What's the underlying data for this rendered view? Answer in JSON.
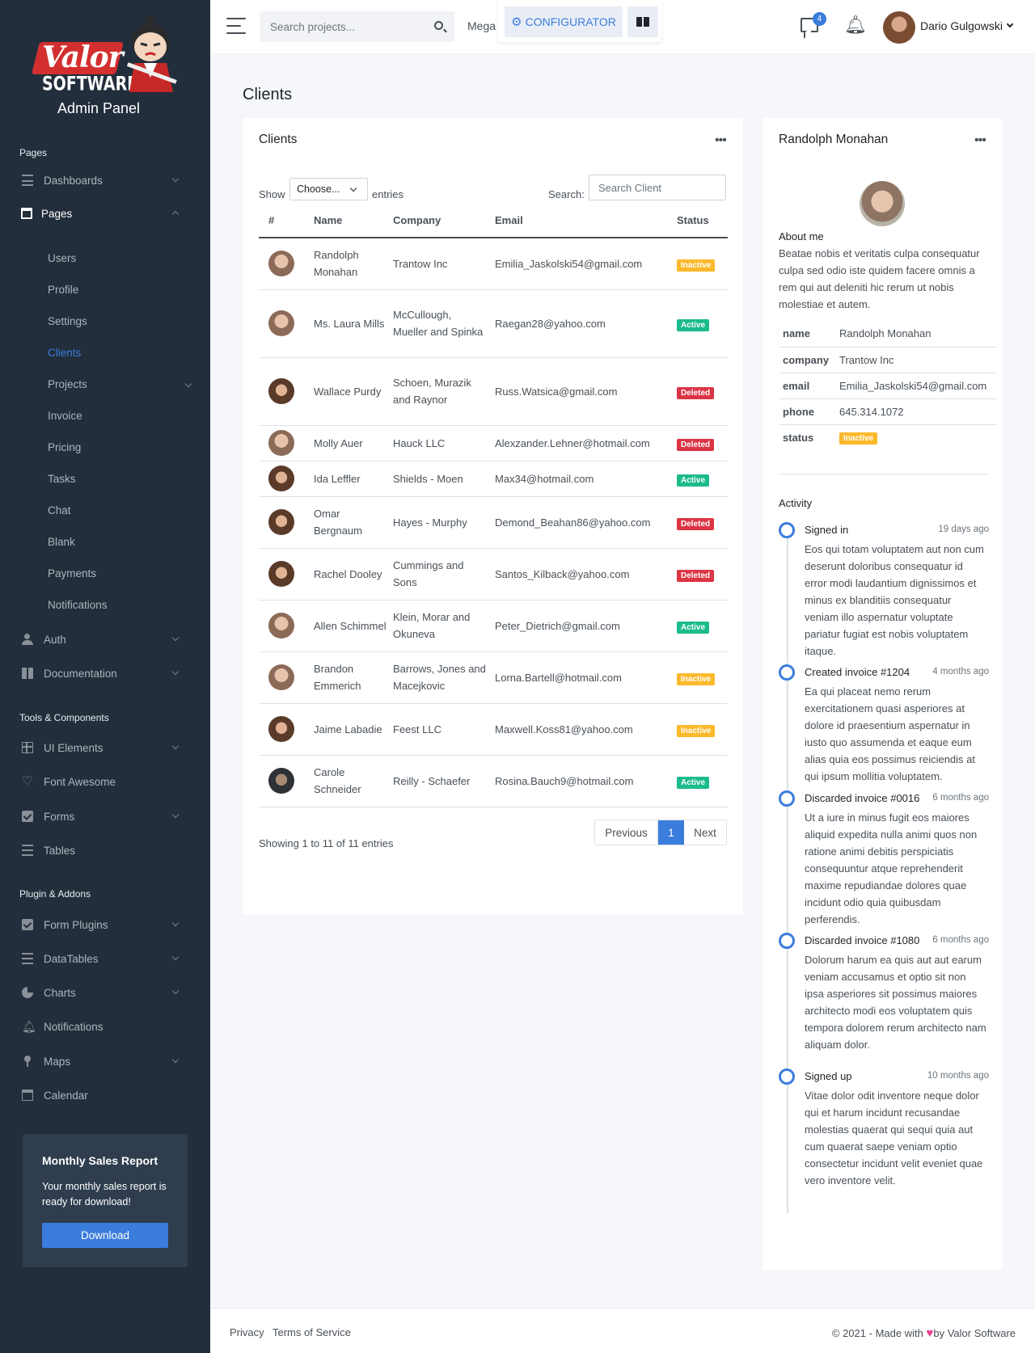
{
  "brand": {
    "logo_text": "Valor",
    "logo_sub": "SOFTWARE",
    "title": "Admin Panel"
  },
  "sidebar": {
    "sections": [
      "Pages",
      "Tools & Components",
      "Plugin & Addons"
    ],
    "pages": [
      {
        "label": "Dashboards",
        "icon": "sliders-icon"
      },
      {
        "label": "Pages",
        "icon": "window-icon"
      }
    ],
    "sub_items": [
      "Users",
      "Profile",
      "Settings",
      "Clients",
      "Projects",
      "Invoice",
      "Pricing",
      "Tasks",
      "Chat",
      "Blank",
      "Payments",
      "Notifications"
    ],
    "pages2": [
      {
        "label": "Auth",
        "icon": "users-icon"
      },
      {
        "label": "Documentation",
        "icon": "book-icon"
      }
    ],
    "tools": [
      {
        "label": "UI Elements",
        "icon": "grid-icon"
      },
      {
        "label": "Font Awesome",
        "icon": "heart-icon"
      },
      {
        "label": "Forms",
        "icon": "check-square-icon"
      },
      {
        "label": "Tables",
        "icon": "list-icon"
      }
    ],
    "plugins": [
      {
        "label": "Form Plugins",
        "icon": "check-square-icon"
      },
      {
        "label": "DataTables",
        "icon": "list-icon"
      },
      {
        "label": "Charts",
        "icon": "pie-chart-icon"
      },
      {
        "label": "Notifications",
        "icon": "bell-icon"
      },
      {
        "label": "Maps",
        "icon": "map-pin-icon"
      },
      {
        "label": "Calendar",
        "icon": "calendar-icon"
      }
    ],
    "promo": {
      "title": "Monthly Sales Report",
      "text": "Your monthly sales report is ready for download!",
      "button": "Download"
    }
  },
  "topbar": {
    "search_placeholder": "Search projects...",
    "mega": "Mega",
    "configurator": "CONFIGURATOR",
    "messages_count": "4",
    "user_name": "Dario Gulgowski"
  },
  "main": {
    "page_title": "Clients",
    "clients_card": {
      "title": "Clients",
      "show": "Show",
      "choose": "Choose...",
      "entries": "entries",
      "search_label": "Search:",
      "search_placeholder": "Search Client",
      "columns": [
        "#",
        "Name",
        "Company",
        "Email",
        "Status"
      ],
      "rows": [
        {
          "name": "Randolph Monahan",
          "company": "Trantow Inc",
          "email": "Emilia_Jaskolski54@gmail.com",
          "status": "Inactive",
          "avatar": "m"
        },
        {
          "name": "Ms. Laura Mills",
          "company": "McCullough, Mueller and Spinka",
          "email": "Raegan28@yahoo.com",
          "status": "Active",
          "avatar": "m"
        },
        {
          "name": "Wallace Purdy",
          "company": "Schoen, Murazik and Raynor",
          "email": "Russ.Watsica@gmail.com",
          "status": "Deleted",
          "avatar": "f"
        },
        {
          "name": "Molly Auer",
          "company": "Hauck LLC",
          "email": "Alexzander.Lehner@hotmail.com",
          "status": "Deleted",
          "avatar": "m"
        },
        {
          "name": "Ida Leffler",
          "company": "Shields - Moen",
          "email": "Max34@hotmail.com",
          "status": "Active",
          "avatar": "f"
        },
        {
          "name": "Omar Bergnaum",
          "company": "Hayes - Murphy",
          "email": "Demond_Beahan86@yahoo.com",
          "status": "Deleted",
          "avatar": "f"
        },
        {
          "name": "Rachel Dooley",
          "company": "Cummings and Sons",
          "email": "Santos_Kilback@yahoo.com",
          "status": "Deleted",
          "avatar": "f"
        },
        {
          "name": "Allen Schimmel",
          "company": "Klein, Morar and Okuneva",
          "email": "Peter_Dietrich@gmail.com",
          "status": "Active",
          "avatar": "m"
        },
        {
          "name": "Brandon Emmerich",
          "company": "Barrows, Jones and Macejkovic",
          "email": "Lorna.Bartell@hotmail.com",
          "status": "Inactive",
          "avatar": "m"
        },
        {
          "name": "Jaime Labadie",
          "company": "Feest LLC",
          "email": "Maxwell.Koss81@yahoo.com",
          "status": "Inactive",
          "avatar": "f"
        },
        {
          "name": "Carole Schneider",
          "company": "Reilly - Schaefer",
          "email": "Rosina.Bauch9@hotmail.com",
          "status": "Active",
          "avatar": "d"
        }
      ],
      "showing": "Showing 1 to 11 of 11 entries",
      "pager": {
        "prev": "Previous",
        "page": "1",
        "next": "Next"
      }
    },
    "profile_card": {
      "title": "Randolph Monahan",
      "about_title": "About me",
      "about_text": "Beatae nobis et veritatis culpa consequatur culpa sed odio iste quidem facere omnis a rem qui aut deleniti hic rerum ut nobis molestiae et autem.",
      "info": [
        {
          "key": "name",
          "value": "Randolph Monahan"
        },
        {
          "key": "company",
          "value": "Trantow Inc"
        },
        {
          "key": "email",
          "value": "Emilia_Jaskolski54@gmail.com"
        },
        {
          "key": "phone",
          "value": "645.314.1072"
        },
        {
          "key": "status",
          "value": "Inactive"
        }
      ],
      "activity_title": "Activity",
      "activity": [
        {
          "title": "Signed in",
          "time": "19 days ago",
          "text": "Eos qui totam voluptatem aut non cum deserunt doloribus consequatur id error modi laudantium dignissimos et minus ex blanditiis consequatur veniam illo aspernatur voluptate pariatur fugiat est nobis voluptatem itaque."
        },
        {
          "title": "Created invoice #1204",
          "time": "4 months ago",
          "text": "Ea qui placeat nemo rerum exercitationem quasi asperiores at dolore id praesentium aspernatur in iusto quo assumenda et eaque eum alias quia eos possimus reiciendis at qui ipsum mollitia voluptatem."
        },
        {
          "title": "Discarded invoice #0016",
          "time": "6 months ago",
          "text": "Ut a iure in minus fugit eos maiores aliquid expedita nulla animi quos non ratione animi debitis perspiciatis consequuntur atque reprehenderit maxime repudiandae dolores quae incidunt odio quia quibusdam perferendis."
        },
        {
          "title": "Discarded invoice #1080",
          "time": "6 months ago",
          "text": "Dolorum harum ea quis aut aut earum veniam accusamus et optio sit non ipsa asperiores sit possimus maiores architecto modi eos voluptatem quis tempora dolorem rerum architecto nam aliquam dolor."
        },
        {
          "title": "Signed up",
          "time": "10 months ago",
          "text": "Vitae dolor odit inventore neque dolor qui et harum incidunt recusandae molestias quaerat qui sequi quia aut cum quaerat saepe veniam optio consectetur incidunt velit eveniet quae vero inventore velit."
        }
      ]
    }
  },
  "footer": {
    "privacy": "Privacy",
    "terms": "Terms of Service",
    "copy_pre": "© 2021 - Made with",
    "copy_post": "by Valor Software"
  },
  "colors": {
    "sidebar": "#222e3c",
    "accent": "#3b7ddd",
    "active": "#1cbb8c",
    "inactive": "#fcb92c",
    "deleted": "#dc3545"
  }
}
